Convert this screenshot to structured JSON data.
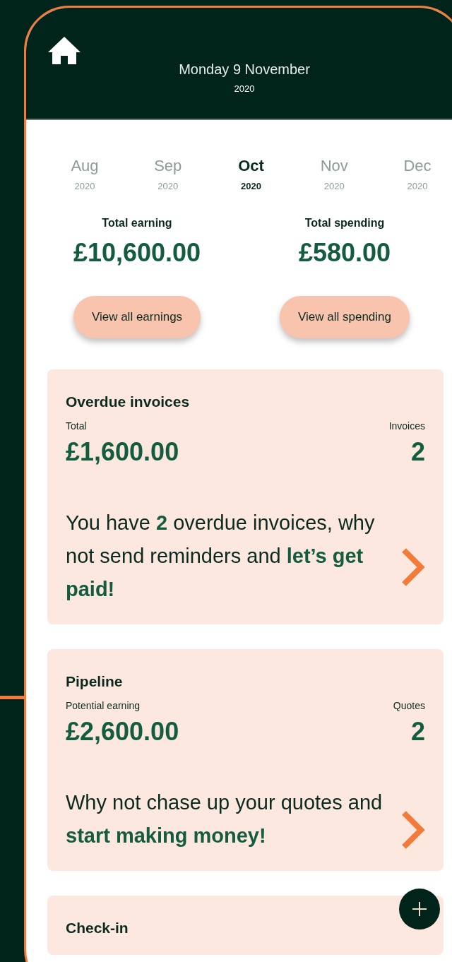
{
  "header": {
    "title": "Monday 9 November",
    "year": "2020"
  },
  "months": [
    {
      "label": "Aug",
      "year": "2020",
      "selected": false
    },
    {
      "label": "Sep",
      "year": "2020",
      "selected": false
    },
    {
      "label": "Oct",
      "year": "2020",
      "selected": true
    },
    {
      "label": "Nov",
      "year": "2020",
      "selected": false
    },
    {
      "label": "Dec",
      "year": "2020",
      "selected": false
    }
  ],
  "totals": [
    {
      "label": "Total earning",
      "amount": "£10,600.00",
      "button": "View all earnings"
    },
    {
      "label": "Total spending",
      "amount": "£580.00",
      "button": "View all spending"
    }
  ],
  "cards": [
    {
      "title": "Overdue invoices",
      "left_label": "Total",
      "amount": "£1,600.00",
      "right_label": "Invoices",
      "count": "2",
      "message": "You have **2** overdue invoices, why not send reminders and **let’s get paid!**"
    },
    {
      "title": "Pipeline",
      "left_label": "Potential earning",
      "amount": "£2,600.00",
      "right_label": "Quotes",
      "count": "2",
      "message": "Why not chase up your quotes and **start making money!**"
    },
    {
      "title": "Check-in"
    }
  ]
}
